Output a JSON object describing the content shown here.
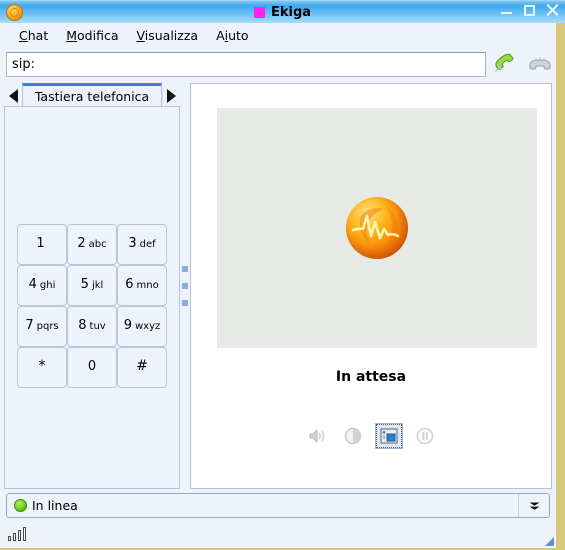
{
  "window": {
    "title": "Ekiga",
    "app_icon": "ekiga-orb-icon",
    "title_square_color": "#ff22ee",
    "buttons": {
      "minimize": "minimize-icon",
      "maximize": "maximize-icon",
      "close": "close-icon"
    }
  },
  "menu": {
    "items": [
      {
        "label": "Chat",
        "mnemonic": "C"
      },
      {
        "label": "Modifica",
        "mnemonic": "M"
      },
      {
        "label": "Visualizza",
        "mnemonic": "V"
      },
      {
        "label": "Aiuto",
        "mnemonic": "i"
      }
    ]
  },
  "toolbar": {
    "sip_value": "sip:",
    "sip_placeholder": "sip:",
    "call_button": "call-handset-icon",
    "hangup_button": "hangup-handset-icon"
  },
  "notebook": {
    "prev_arrow": "chevron-left-icon",
    "next_arrow": "chevron-right-icon",
    "tabs": [
      {
        "label": "Tastiera telefonica",
        "active": true
      }
    ]
  },
  "keypad": {
    "keys": [
      {
        "digit": "1",
        "letters": ""
      },
      {
        "digit": "2",
        "letters": "abc"
      },
      {
        "digit": "3",
        "letters": "def"
      },
      {
        "digit": "4",
        "letters": "ghi"
      },
      {
        "digit": "5",
        "letters": "jkl"
      },
      {
        "digit": "6",
        "letters": "mno"
      },
      {
        "digit": "7",
        "letters": "pqrs"
      },
      {
        "digit": "8",
        "letters": "tuv"
      },
      {
        "digit": "9",
        "letters": "wxyz"
      },
      {
        "digit": "*",
        "letters": ""
      },
      {
        "digit": "0",
        "letters": ""
      },
      {
        "digit": "#",
        "letters": ""
      }
    ]
  },
  "call_panel": {
    "video_placeholder_color": "#e6e9e6",
    "logo": "ekiga-orb-logo",
    "call_status": "In attesa",
    "controls": [
      {
        "name": "audio-volume-icon",
        "selected": false
      },
      {
        "name": "brightness-contrast-icon",
        "selected": false
      },
      {
        "name": "video-settings-icon",
        "selected": true
      },
      {
        "name": "pause-call-icon",
        "selected": false
      }
    ]
  },
  "presence": {
    "status_label": "In linea",
    "status_color": "#6bc81c",
    "dropdown_arrow": "chevron-down-icon"
  },
  "statusbar": {
    "network_icon": "signal-bars-icon",
    "resize_grip": "resize-grip-icon"
  }
}
